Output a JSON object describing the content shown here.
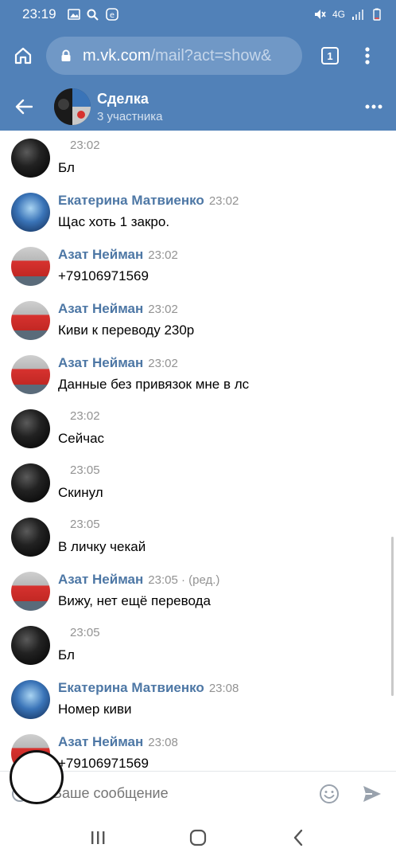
{
  "status_bar": {
    "time": "23:19",
    "network": "4G"
  },
  "browser": {
    "url_host": "m.vk.com",
    "url_path": "/mail?act=show&",
    "tab_count": "1"
  },
  "chat": {
    "title": "Сделка",
    "subtitle": "3 участника"
  },
  "messages": [
    {
      "author": "",
      "time": "23:02",
      "edited": "",
      "text": "Бл",
      "avatar": "dark"
    },
    {
      "author": "Екатерина Матвиенко",
      "time": "23:02",
      "edited": "",
      "text": "Щас хоть 1 закро.",
      "avatar": "blue"
    },
    {
      "author": "Азат Нейман",
      "time": "23:02",
      "edited": "",
      "text": "+79106971569",
      "avatar": "red"
    },
    {
      "author": "Азат Нейман",
      "time": "23:02",
      "edited": "",
      "text": "Киви к переводу 230р",
      "avatar": "red"
    },
    {
      "author": "Азат Нейман",
      "time": "23:02",
      "edited": "",
      "text": "Данные без привязок мне в лс",
      "avatar": "red"
    },
    {
      "author": "",
      "time": "23:02",
      "edited": "",
      "text": "Сейчас",
      "avatar": "dark"
    },
    {
      "author": "",
      "time": "23:05",
      "edited": "",
      "text": "Скинул",
      "avatar": "dark"
    },
    {
      "author": "",
      "time": "23:05",
      "edited": "",
      "text": "В личку чекай",
      "avatar": "dark"
    },
    {
      "author": "Азат Нейман",
      "time": "23:05",
      "edited": " · (ред.)",
      "text": "Вижу, нет ещё перевода",
      "avatar": "red"
    },
    {
      "author": "",
      "time": "23:05",
      "edited": "",
      "text": "Бл",
      "avatar": "dark"
    },
    {
      "author": "Екатерина Матвиенко",
      "time": "23:08",
      "edited": "",
      "text": "Номер киви",
      "avatar": "blue"
    },
    {
      "author": "Азат Нейман",
      "time": "23:08",
      "edited": "",
      "text": "+79106971569",
      "avatar": "red"
    }
  ],
  "compose": {
    "placeholder": "Ваше сообщение"
  },
  "icons": {
    "home": "home-icon",
    "lock": "lock-icon",
    "menu": "more-vertical-icon",
    "back": "arrow-back-icon",
    "more": "more-horizontal-icon",
    "emoji": "emoji-icon",
    "send": "send-icon"
  },
  "colors": {
    "header": "#5181b8",
    "author": "#4d77a5"
  }
}
